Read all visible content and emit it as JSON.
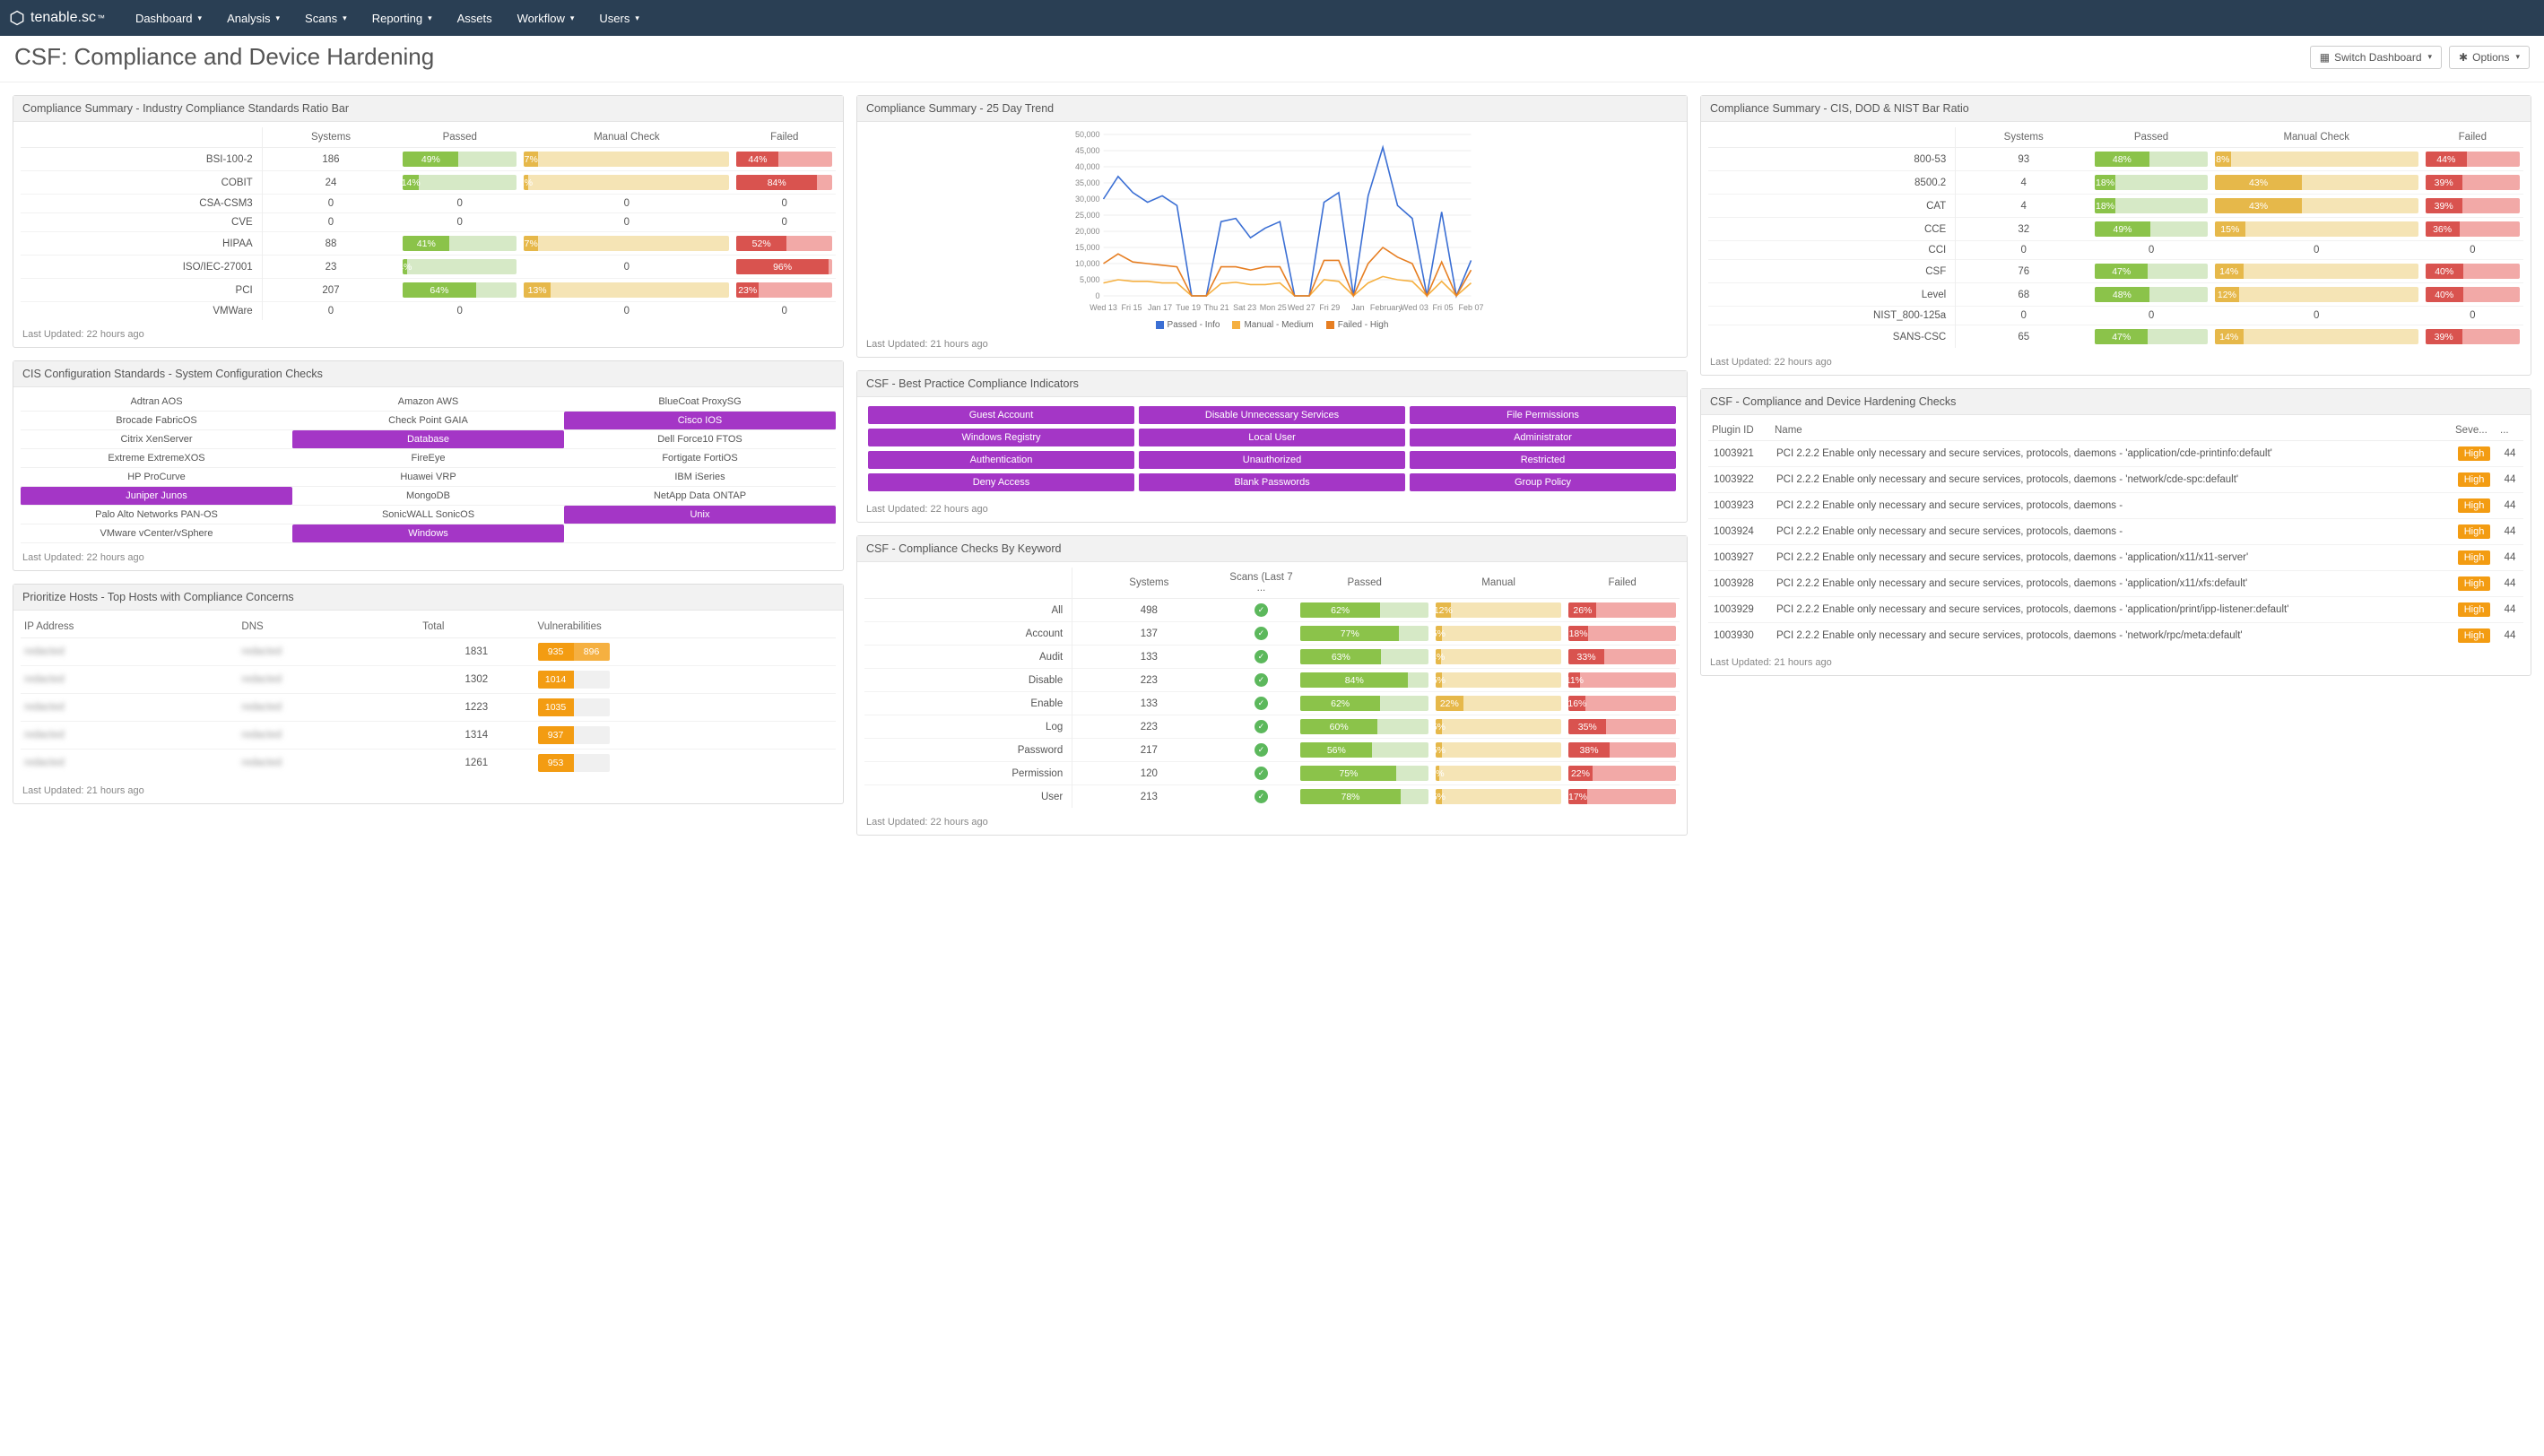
{
  "brand": {
    "name": "tenable.sc"
  },
  "nav": [
    "Dashboard",
    "Analysis",
    "Scans",
    "Reporting",
    "Assets",
    "Workflow",
    "Users"
  ],
  "page_title": "CSF: Compliance and Device Hardening",
  "buttons": {
    "switch": "Switch Dashboard",
    "options": "Options"
  },
  "panels": {
    "industry": {
      "title": "Compliance Summary - Industry Compliance Standards Ratio Bar",
      "columns": [
        "",
        "Systems",
        "Passed",
        "Manual Check",
        "Failed"
      ],
      "rows": [
        {
          "label": "BSI-100-2",
          "systems": 186,
          "passed": 49,
          "manual": 7,
          "failed": 44
        },
        {
          "label": "COBIT",
          "systems": 24,
          "passed": 14,
          "manual": 2,
          "failed": 84
        },
        {
          "label": "CSA-CSM3",
          "systems": 0,
          "passed": 0,
          "manual": 0,
          "failed": 0
        },
        {
          "label": "CVE",
          "systems": 0,
          "passed": 0,
          "manual": 0,
          "failed": 0
        },
        {
          "label": "HIPAA",
          "systems": 88,
          "passed": 41,
          "manual": 7,
          "failed": 52
        },
        {
          "label": "ISO/IEC-27001",
          "systems": 23,
          "passed": 4,
          "manual": 0,
          "failed": 96
        },
        {
          "label": "PCI",
          "systems": 207,
          "passed": 64,
          "manual": 13,
          "failed": 23
        },
        {
          "label": "VMWare",
          "systems": 0,
          "passed": 0,
          "manual": 0,
          "failed": 0
        }
      ],
      "updated": "Last Updated: 22 hours ago"
    },
    "trend": {
      "title": "Compliance Summary - 25 Day Trend",
      "legend": [
        "Passed - Info",
        "Manual - Medium",
        "Failed - High"
      ],
      "xticks": [
        "Wed 13",
        "Fri 15",
        "Jan 17",
        "Tue 19",
        "Thu 21",
        "Sat 23",
        "Mon 25",
        "Wed 27",
        "Fri 29",
        "Jan",
        "February",
        "Wed 03",
        "Fri 05",
        "Feb 07"
      ],
      "updated": "Last Updated: 21 hours ago"
    },
    "cisdod": {
      "title": "Compliance Summary - CIS, DOD & NIST Bar Ratio",
      "columns": [
        "",
        "Systems",
        "Passed",
        "Manual Check",
        "Failed"
      ],
      "rows": [
        {
          "label": "800-53",
          "systems": 93,
          "passed": 48,
          "manual": 8,
          "failed": 44
        },
        {
          "label": "8500.2",
          "systems": 4,
          "passed": 18,
          "manual": 43,
          "failed": 39
        },
        {
          "label": "CAT",
          "systems": 4,
          "passed": 18,
          "manual": 43,
          "failed": 39
        },
        {
          "label": "CCE",
          "systems": 32,
          "passed": 49,
          "manual": 15,
          "failed": 36
        },
        {
          "label": "CCI",
          "systems": 0,
          "passed": 0,
          "manual": 0,
          "failed": 0
        },
        {
          "label": "CSF",
          "systems": 76,
          "passed": 47,
          "manual": 14,
          "failed": 40
        },
        {
          "label": "Level",
          "systems": 68,
          "passed": 48,
          "manual": 12,
          "failed": 40
        },
        {
          "label": "NIST_800-125a",
          "systems": 0,
          "passed": 0,
          "manual": 0,
          "failed": 0
        },
        {
          "label": "SANS-CSC",
          "systems": 65,
          "passed": 47,
          "manual": 14,
          "failed": 39
        }
      ],
      "updated": "Last Updated: 22 hours ago"
    },
    "cis": {
      "title": "CIS Configuration Standards - System Configuration Checks",
      "items": [
        {
          "label": "Adtran AOS",
          "hl": false
        },
        {
          "label": "Amazon AWS",
          "hl": false
        },
        {
          "label": "BlueCoat ProxySG",
          "hl": false
        },
        {
          "label": "Brocade FabricOS",
          "hl": false
        },
        {
          "label": "Check Point GAIA",
          "hl": false
        },
        {
          "label": "Cisco IOS",
          "hl": true
        },
        {
          "label": "Citrix XenServer",
          "hl": false
        },
        {
          "label": "Database",
          "hl": true
        },
        {
          "label": "Dell Force10 FTOS",
          "hl": false
        },
        {
          "label": "Extreme ExtremeXOS",
          "hl": false
        },
        {
          "label": "FireEye",
          "hl": false
        },
        {
          "label": "Fortigate FortiOS",
          "hl": false
        },
        {
          "label": "HP ProCurve",
          "hl": false
        },
        {
          "label": "Huawei VRP",
          "hl": false
        },
        {
          "label": "IBM iSeries",
          "hl": false
        },
        {
          "label": "Juniper Junos",
          "hl": true
        },
        {
          "label": "MongoDB",
          "hl": false
        },
        {
          "label": "NetApp Data ONTAP",
          "hl": false
        },
        {
          "label": "Palo Alto Networks PAN-OS",
          "hl": false
        },
        {
          "label": "SonicWALL SonicOS",
          "hl": false
        },
        {
          "label": "Unix",
          "hl": true
        },
        {
          "label": "VMware vCenter/vSphere",
          "hl": false
        },
        {
          "label": "Windows",
          "hl": true
        },
        {
          "label": "",
          "hl": false
        }
      ],
      "updated": "Last Updated: 22 hours ago"
    },
    "hosts": {
      "title": "Prioritize Hosts - Top Hosts with Compliance Concerns",
      "columns": [
        "IP Address",
        "DNS",
        "Total",
        "Vulnerabilities"
      ],
      "rows": [
        {
          "ip": "redacted",
          "dns": "redacted",
          "total": 1831,
          "v": [
            935,
            896
          ]
        },
        {
          "ip": "redacted",
          "dns": "redacted",
          "total": 1302,
          "v": [
            1014,
            null
          ]
        },
        {
          "ip": "redacted",
          "dns": "redacted",
          "total": 1223,
          "v": [
            1035,
            null
          ]
        },
        {
          "ip": "redacted",
          "dns": "redacted",
          "total": 1314,
          "v": [
            937,
            null
          ]
        },
        {
          "ip": "redacted",
          "dns": "redacted",
          "total": 1261,
          "v": [
            953,
            null
          ]
        }
      ],
      "updated": "Last Updated: 21 hours ago"
    },
    "indicators": {
      "title": "CSF - Best Practice Compliance Indicators",
      "items": [
        "Guest Account",
        "Disable Unnecessary Services",
        "File Permissions",
        "Windows Registry",
        "Local User",
        "Administrator",
        "Authentication",
        "Unauthorized",
        "Restricted",
        "Deny Access",
        "Blank Passwords",
        "Group Policy"
      ],
      "updated": "Last Updated: 22 hours ago"
    },
    "keyword": {
      "title": "CSF - Compliance Checks By Keyword",
      "columns": [
        "",
        "Systems",
        "Scans (Last 7 ...",
        "Passed",
        "Manual",
        "Failed"
      ],
      "rows": [
        {
          "label": "All",
          "systems": 498,
          "passed": 62,
          "manual": 12,
          "failed": 26
        },
        {
          "label": "Account",
          "systems": 137,
          "passed": 77,
          "manual": 5,
          "failed": 18
        },
        {
          "label": "Audit",
          "systems": 133,
          "passed": 63,
          "manual": 4,
          "failed": 33
        },
        {
          "label": "Disable",
          "systems": 223,
          "passed": 84,
          "manual": 5,
          "failed": 11
        },
        {
          "label": "Enable",
          "systems": 133,
          "passed": 62,
          "manual": 22,
          "failed": 16
        },
        {
          "label": "Log",
          "systems": 223,
          "passed": 60,
          "manual": 5,
          "failed": 35
        },
        {
          "label": "Password",
          "systems": 217,
          "passed": 56,
          "manual": 5,
          "failed": 38
        },
        {
          "label": "Permission",
          "systems": 120,
          "passed": 75,
          "manual": 3,
          "failed": 22
        },
        {
          "label": "User",
          "systems": 213,
          "passed": 78,
          "manual": 5,
          "failed": 17
        }
      ],
      "updated": "Last Updated: 22 hours ago"
    },
    "hardening": {
      "title": "CSF - Compliance and Device Hardening Checks",
      "columns": [
        "Plugin ID",
        "Name",
        "Seve...",
        "..."
      ],
      "severity_label": "High",
      "count": 44,
      "rows": [
        {
          "id": 1003921,
          "name": "PCI 2.2.2 Enable only necessary and secure services, protocols, daemons - 'application/cde-printinfo:default'"
        },
        {
          "id": 1003922,
          "name": "PCI 2.2.2 Enable only necessary and secure services, protocols, daemons - 'network/cde-spc:default'"
        },
        {
          "id": 1003923,
          "name": "PCI 2.2.2 Enable only necessary and secure services, protocols, daemons -"
        },
        {
          "id": 1003924,
          "name": "PCI 2.2.2 Enable only necessary and secure services, protocols, daemons -"
        },
        {
          "id": 1003927,
          "name": "PCI 2.2.2 Enable only necessary and secure services, protocols, daemons - 'application/x11/x11-server'"
        },
        {
          "id": 1003928,
          "name": "PCI 2.2.2 Enable only necessary and secure services, protocols, daemons - 'application/x11/xfs:default'"
        },
        {
          "id": 1003929,
          "name": "PCI 2.2.2 Enable only necessary and secure services, protocols, daemons - 'application/print/ipp-listener:default'"
        },
        {
          "id": 1003930,
          "name": "PCI 2.2.2 Enable only necessary and secure services, protocols, daemons - 'network/rpc/meta:default'"
        }
      ],
      "updated": "Last Updated: 21 hours ago"
    }
  },
  "chart_data": {
    "type": "line",
    "title": "Compliance Summary - 25 Day Trend",
    "ylim": [
      0,
      50000
    ],
    "yticks": [
      0,
      5000,
      10000,
      15000,
      20000,
      25000,
      30000,
      35000,
      40000,
      45000,
      50000
    ],
    "x": [
      "Wed 13",
      "Fri 15",
      "Jan 17",
      "Tue 19",
      "Thu 21",
      "Sat 23",
      "Mon 25",
      "Wed 27",
      "Fri 29",
      "Jan",
      "February",
      "Wed 03",
      "Fri 05",
      "Feb 07"
    ],
    "series": [
      {
        "name": "Passed - Info",
        "color": "#3b6fd4",
        "values": [
          30000,
          37000,
          32000,
          29000,
          31000,
          28000,
          0,
          0,
          23000,
          24000,
          18000,
          21000,
          23000,
          0,
          0,
          29000,
          32000,
          0,
          31000,
          46000,
          28000,
          24000,
          0,
          26000,
          0,
          11000
        ]
      },
      {
        "name": "Manual - Medium",
        "color": "#f5b041",
        "values": [
          4000,
          5000,
          4500,
          4500,
          4000,
          4000,
          0,
          0,
          3800,
          4200,
          3500,
          3500,
          4000,
          0,
          0,
          5000,
          4500,
          0,
          4000,
          6000,
          5000,
          4500,
          0,
          4500,
          0,
          4000
        ]
      },
      {
        "name": "Failed - High",
        "color": "#e67e22",
        "values": [
          10000,
          13000,
          10500,
          10000,
          9500,
          9000,
          0,
          0,
          9000,
          9000,
          8000,
          9000,
          9000,
          0,
          0,
          11000,
          11000,
          0,
          10000,
          15000,
          12000,
          10000,
          0,
          10500,
          0,
          8000
        ]
      }
    ]
  }
}
